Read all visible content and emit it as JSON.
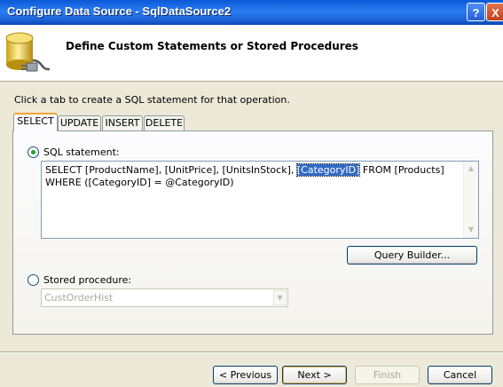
{
  "window": {
    "title": "Configure Data Source - SqlDataSource2"
  },
  "titlebar": {
    "help_label": "?",
    "close_label": "X"
  },
  "header": {
    "title": "Define Custom Statements or Stored Procedures",
    "icon": "database-icon"
  },
  "instruction": "Click a tab to create a SQL statement for that operation.",
  "tabs": [
    {
      "label": "SELECT",
      "active": true
    },
    {
      "label": "UPDATE",
      "active": false
    },
    {
      "label": "INSERT",
      "active": false
    },
    {
      "label": "DELETE",
      "active": false
    }
  ],
  "sql_option": {
    "label": "SQL statement:",
    "selected": true,
    "text_before": "SELECT [ProductName], [UnitPrice], [UnitsInStock], ",
    "text_selected": "[CategoryID]",
    "text_after": " FROM [Products] WHERE ([CategoryID] = @CategoryID)"
  },
  "query_builder_label": "Query Builder...",
  "stored_proc_option": {
    "label": "Stored procedure:",
    "selected": false,
    "value": "CustOrderHist"
  },
  "buttons": {
    "previous": "< Previous",
    "next": "Next >",
    "finish": "Finish",
    "cancel": "Cancel"
  },
  "colors": {
    "titlebar": "#0a5ad8",
    "selection": "#316ac5",
    "active_tab_accent": "#f1a436",
    "radio_dot": "#21a121"
  }
}
